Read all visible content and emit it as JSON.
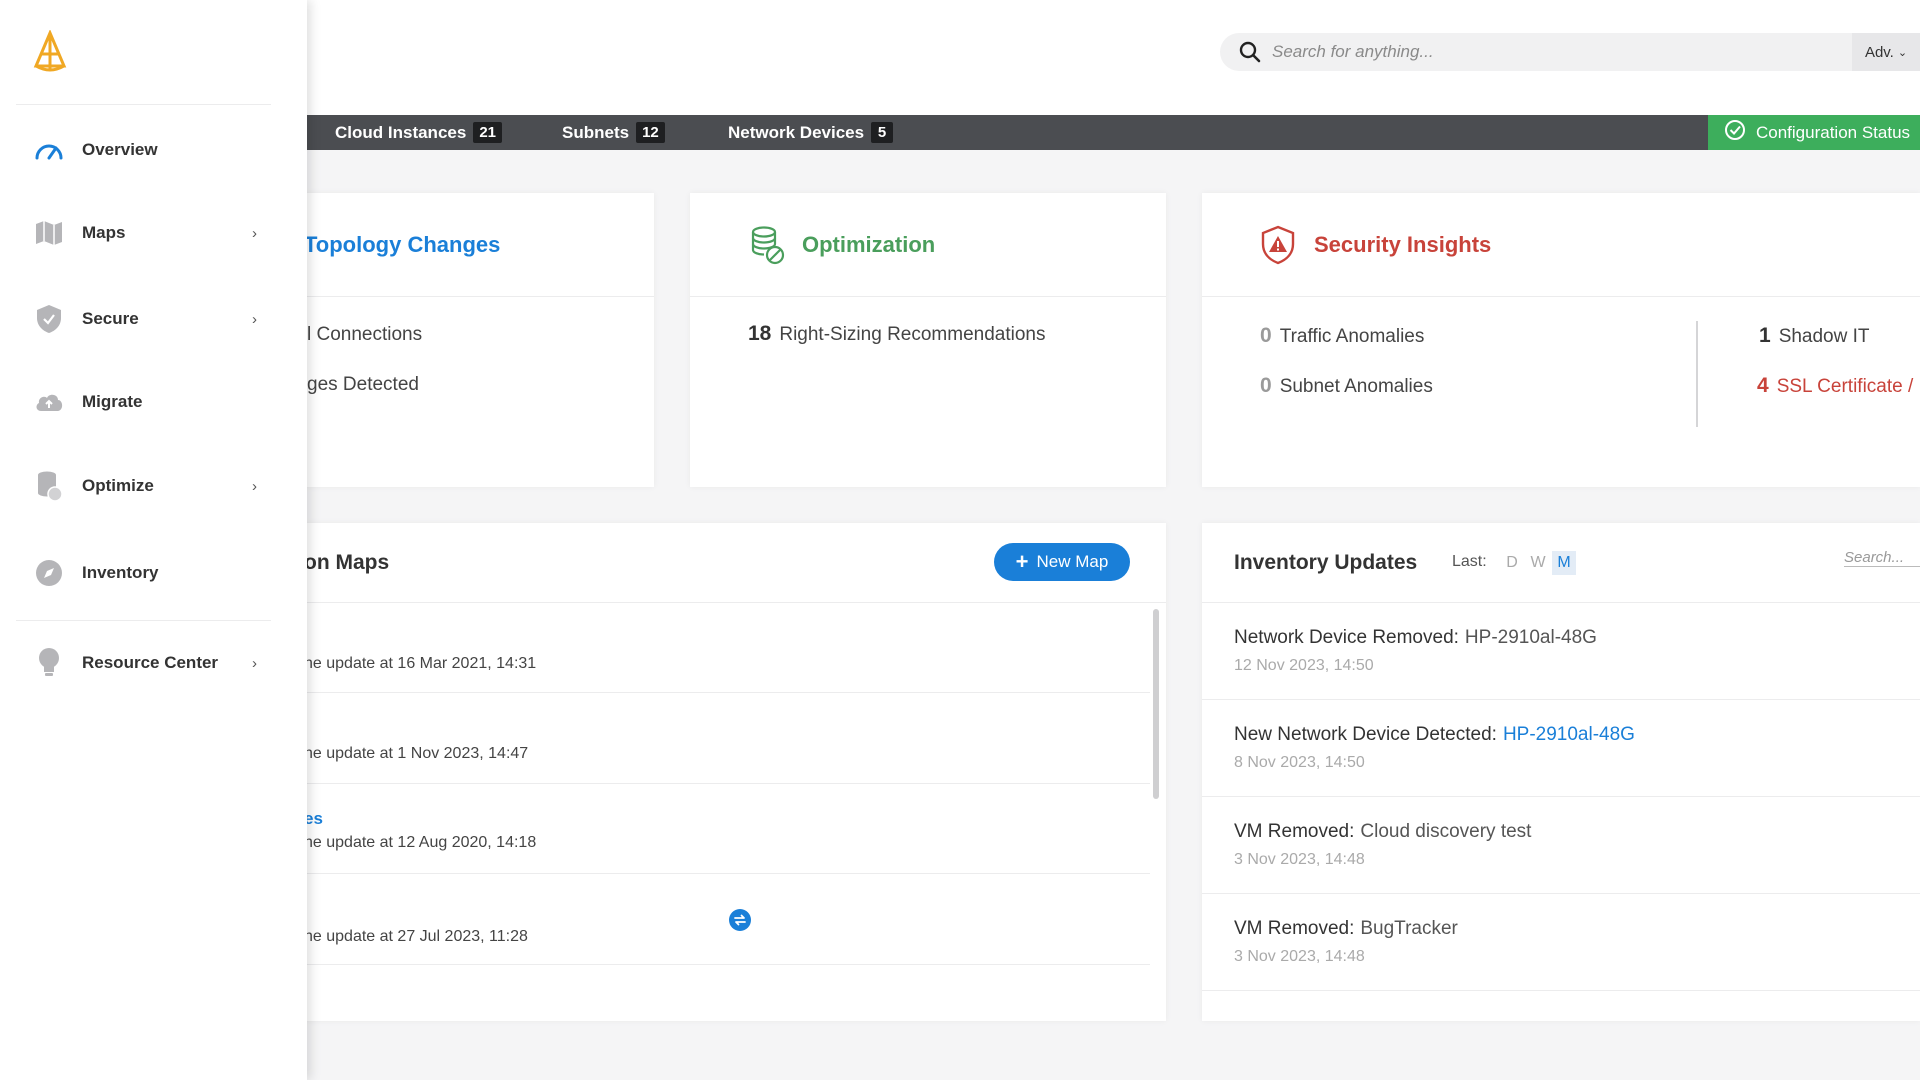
{
  "header": {
    "search_placeholder": "Search for anything...",
    "adv_label": "Adv."
  },
  "strip": {
    "items": [
      {
        "label": "Cloud Instances",
        "count": "21"
      },
      {
        "label": "Subnets",
        "count": "12"
      },
      {
        "label": "Network Devices",
        "count": "5"
      }
    ],
    "config_status": "Configuration Status"
  },
  "topology": {
    "title": "Topology Changes",
    "rows": [
      "l Connections",
      "ges Detected"
    ]
  },
  "optimization": {
    "title": "Optimization",
    "count": "18",
    "label": "Right-Sizing Recommendations"
  },
  "security": {
    "title": "Security Insights",
    "rows": [
      {
        "count": "0",
        "label": "Traffic Anomalies"
      },
      {
        "count": "0",
        "label": "Subnet Anomalies"
      },
      {
        "count": "1",
        "label": "Shadow IT"
      },
      {
        "count": "4",
        "label": "SSL Certificate /"
      }
    ]
  },
  "maps": {
    "title": "on Maps",
    "new_map_label": "New Map",
    "rows": [
      {
        "link": "",
        "update": "he update at 16 Mar 2021, 14:31"
      },
      {
        "link": "",
        "update": "he update at 1 Nov 2023, 14:47"
      },
      {
        "link": "es",
        "update": "he update at 12 Aug 2020, 14:18"
      },
      {
        "link": "",
        "update": "he update at 27 Jul 2023, 11:28"
      }
    ]
  },
  "inventory": {
    "title": "Inventory Updates",
    "last_label": "Last:",
    "ranges": [
      "D",
      "W",
      "M"
    ],
    "active_range": "M",
    "search_placeholder": "Search...",
    "rows": [
      {
        "label": "Network Device Removed:",
        "value": "HP-2910al-48G",
        "time": "12 Nov 2023, 14:50"
      },
      {
        "label": "New Network Device Detected:",
        "value": "HP-2910al-48G",
        "time": "8 Nov 2023, 14:50"
      },
      {
        "label": "VM Removed:",
        "value": "Cloud discovery test",
        "time": "3 Nov 2023, 14:48"
      },
      {
        "label": "VM Removed:",
        "value": "BugTracker",
        "time": "3 Nov 2023, 14:48"
      }
    ]
  },
  "sidebar": {
    "items": [
      {
        "label": "Overview",
        "icon": "speedometer-icon",
        "chevron": false
      },
      {
        "label": "Maps",
        "icon": "map-icon",
        "chevron": true
      },
      {
        "label": "Secure",
        "icon": "shield-icon",
        "chevron": true
      },
      {
        "label": "Migrate",
        "icon": "cloud-upload-icon",
        "chevron": false
      },
      {
        "label": "Optimize",
        "icon": "coins-icon",
        "chevron": true
      },
      {
        "label": "Inventory",
        "icon": "compass-icon",
        "chevron": false
      },
      {
        "label": "Resource Center",
        "icon": "lightbulb-icon",
        "chevron": true
      }
    ],
    "chevron": "›"
  },
  "colors": {
    "accent": "#1a7fd8",
    "success": "#3dae5c",
    "danger": "#c8433a",
    "optimization": "#4a9e5c",
    "strip": "#4b4d51"
  }
}
